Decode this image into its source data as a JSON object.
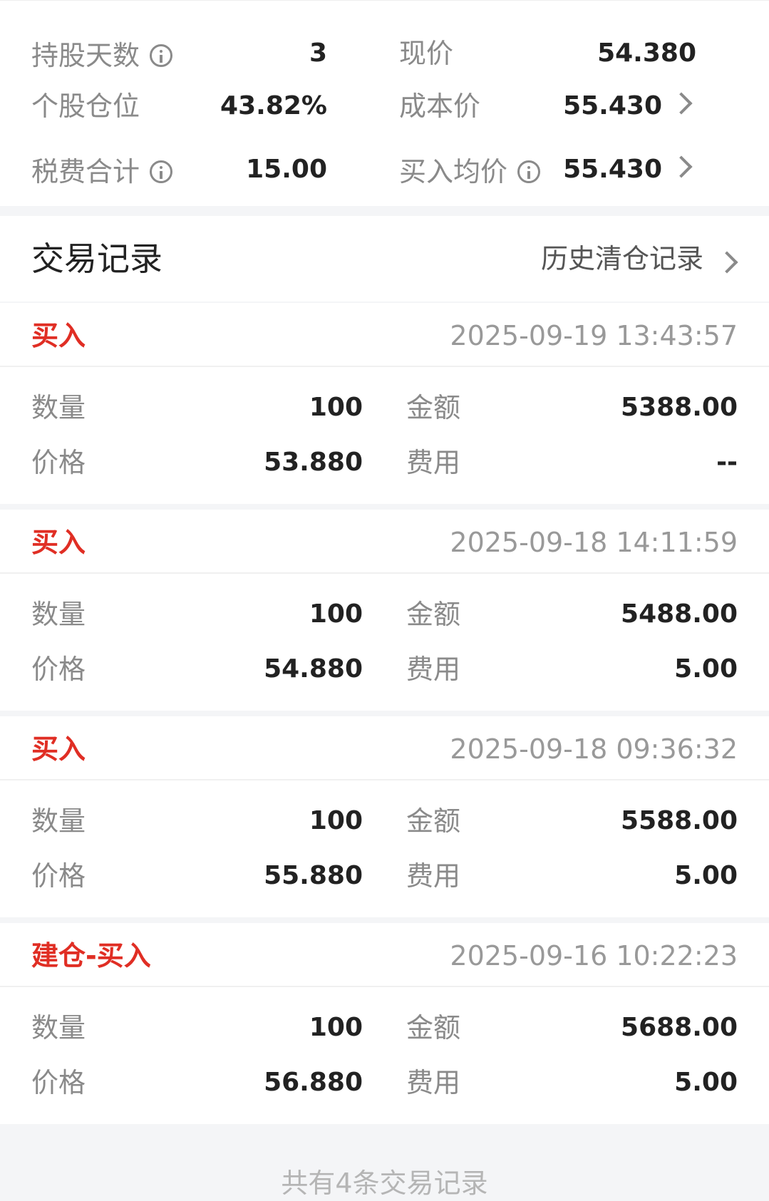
{
  "summary": {
    "holding_days_label": "持股天数",
    "holding_days_value": "3",
    "current_price_label": "现价",
    "current_price_value": "54.380",
    "position_ratio_label": "个股仓位",
    "position_ratio_value": "43.82%",
    "cost_price_label": "成本价",
    "cost_price_value": "55.430",
    "tax_fee_label": "税费合计",
    "tax_fee_value": "15.00",
    "avg_buy_price_label": "买入均价",
    "avg_buy_price_value": "55.430"
  },
  "trade_header": {
    "title": "交易记录",
    "history_link": "历史清仓记录"
  },
  "trade_labels": {
    "quantity": "数量",
    "price": "价格",
    "amount": "金额",
    "fee": "费用"
  },
  "trades": [
    {
      "type": "买入",
      "time": "2025-09-19 13:43:57",
      "quantity": "100",
      "price": "53.880",
      "amount": "5388.00",
      "fee": "--"
    },
    {
      "type": "买入",
      "time": "2025-09-18 14:11:59",
      "quantity": "100",
      "price": "54.880",
      "amount": "5488.00",
      "fee": "5.00"
    },
    {
      "type": "买入",
      "time": "2025-09-18 09:36:32",
      "quantity": "100",
      "price": "55.880",
      "amount": "5588.00",
      "fee": "5.00"
    },
    {
      "type": "建仓-买入",
      "time": "2025-09-16 10:22:23",
      "quantity": "100",
      "price": "56.880",
      "amount": "5688.00",
      "fee": "5.00"
    }
  ],
  "footer": {
    "text": "共有4条交易记录"
  },
  "colors": {
    "buy_red": "#e02e24",
    "label_gray": "#8a8a8a",
    "value_dark": "#222222"
  },
  "icons": [
    "info-icon",
    "chevron-right-icon"
  ]
}
